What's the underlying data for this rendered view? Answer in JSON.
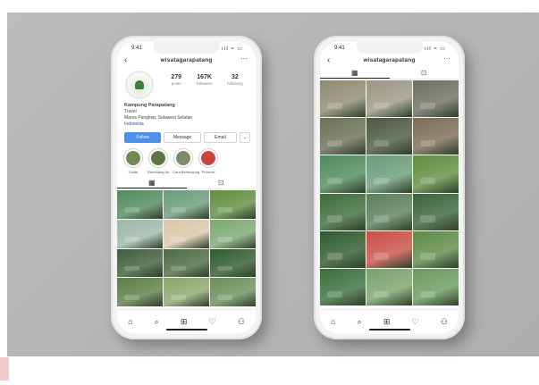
{
  "profile": {
    "username": "wisatagarapatang",
    "status_time": "9:41",
    "stats": [
      {
        "num": "279",
        "label": "posts"
      },
      {
        "num": "167K",
        "label": "followers"
      },
      {
        "num": "32",
        "label": "following"
      }
    ],
    "bio": {
      "name": "Kampung Parapatang",
      "category": "Travel",
      "line": "Maros Pangkep, Sulawesi Selatan",
      "link": "Indonesia"
    },
    "buttons": {
      "follow": "Follow",
      "message": "Message",
      "email": "Email",
      "more": "⌄"
    },
    "highlights": [
      {
        "caption": "Guide",
        "color": "#6f8a52"
      },
      {
        "caption": "Rammang Itu",
        "color": "#5d7640"
      },
      {
        "caption": "Cara Berkunjung",
        "color": "#7a8c6b"
      },
      {
        "caption": "Promosi",
        "color": "#c9453f"
      }
    ]
  },
  "tabs": {
    "grid_icon": "▦",
    "tagged_icon": "⊡"
  },
  "icons": {
    "back": "‹",
    "more": "···",
    "signal": "ııl ≈ ▭",
    "home": "⌂",
    "search": "⌕",
    "add": "⊞",
    "heart": "♡",
    "user": "⚇"
  },
  "left_grid_colors": [
    "#4f8a5c",
    "#6a9b7a",
    "#5f8e3f",
    "#9eb7a8",
    "#d8c7a9",
    "#7ba871",
    "#3f5c38",
    "#4b6a3f",
    "#2f5a2c",
    "#5b7d45",
    "#8aa66a",
    "#6a8f59"
  ],
  "right_grid_colors": [
    "#8e8a73",
    "#9b9785",
    "#6d6d62",
    "#6a6f55",
    "#4b5841",
    "#7a6b55",
    "#4f8a5c",
    "#6a9b7a",
    "#5f8e3f",
    "#3c6b3a",
    "#5a7f5b",
    "#39633a",
    "#2f5a2c",
    "#c84f45",
    "#5d8a46",
    "#3a6e3a",
    "#7aa26b",
    "#6a9a5f"
  ]
}
